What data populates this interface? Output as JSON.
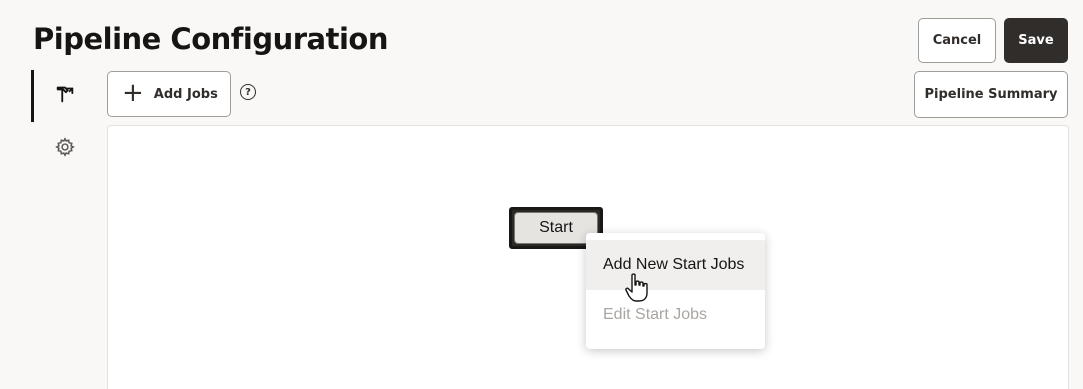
{
  "header": {
    "title": "Pipeline Configuration",
    "cancel_label": "Cancel",
    "save_label": "Save"
  },
  "toolbar": {
    "add_jobs_label": "Add Jobs",
    "help_icon": "question-circle-icon",
    "pipeline_summary_label": "Pipeline Summary"
  },
  "rail": {
    "items": [
      {
        "icon": "hammer-icon",
        "active": true
      },
      {
        "icon": "gear-icon",
        "active": false
      }
    ]
  },
  "canvas": {
    "start_node_label": "Start"
  },
  "context_menu": {
    "items": [
      {
        "label": "Add New Start Jobs",
        "state": "hover"
      },
      {
        "label": "Edit Start Jobs",
        "state": "disabled"
      }
    ]
  },
  "colors": {
    "primary_button": "#312d2a",
    "page_background": "#f9f8f6",
    "disabled_text": "#a9a5a0"
  }
}
